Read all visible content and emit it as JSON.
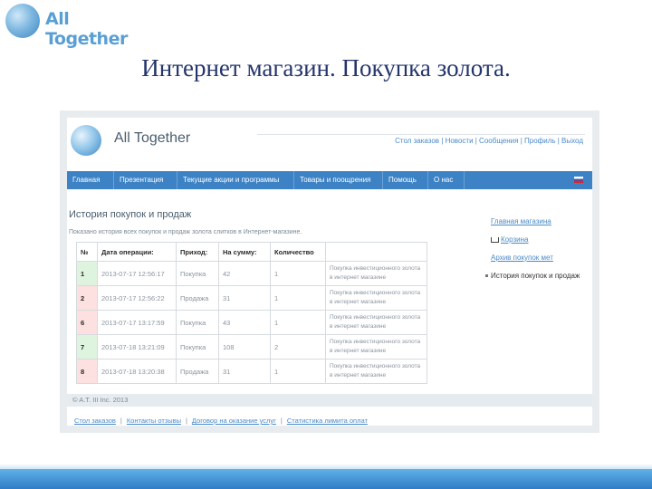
{
  "slide": {
    "logo_text": "All Together",
    "title": "Интернет магазин. Покупка золота."
  },
  "site": {
    "name": "All Together",
    "top_links": "Стол заказов | Новости | Сообщения | Профиль | Выход",
    "nav": [
      "Главная",
      "Презентация",
      "Текущие акции и программы",
      "Товары и поощрения",
      "Помощь",
      "О нас"
    ],
    "history_title": "История покупок и продаж",
    "history_desc": "Показано история всех покупок и продаж золота слитков в Интернет-магазине.",
    "table": {
      "headers": [
        "№",
        "Дата операции:",
        "Приход:",
        "На сумму:",
        "Количество",
        ""
      ],
      "rows": [
        {
          "n": "1",
          "date": "2013-07-17 12:56:17",
          "type": "Покупка",
          "sum": "42",
          "qty": "1",
          "desc": "Покупка инвестиционного золота в интернет магазине"
        },
        {
          "n": "2",
          "date": "2013-07-17 12:56:22",
          "type": "Продажа",
          "sum": "31",
          "qty": "1",
          "desc": "Покупка инвестиционного золота в интернет магазине"
        },
        {
          "n": "6",
          "date": "2013-07-17 13:17:59",
          "type": "Покупка",
          "sum": "43",
          "qty": "1",
          "desc": "Покупка инвестиционного золота в интернет магазине"
        },
        {
          "n": "7",
          "date": "2013-07-18 13:21:09",
          "type": "Покупка",
          "sum": "108",
          "qty": "2",
          "desc": "Покупка инвестиционного золота в интернет магазине"
        },
        {
          "n": "8",
          "date": "2013-07-18 13:20:38",
          "type": "Продажа",
          "sum": "31",
          "qty": "1",
          "desc": "Покупка инвестиционного золота в интернет магазине"
        }
      ]
    },
    "sidebar": {
      "main_link": "Главная магазина",
      "cart": "Корзина",
      "history_link": "Архив покупок мет",
      "active": "История покупок и продаж"
    },
    "copyright": "© A.T. III Inc. 2013",
    "footer_links": [
      "Стол заказов",
      "Контакты отзывы",
      "Договор на оказание услуг",
      "Статистика лимита оплат"
    ]
  },
  "colors": {
    "nav": "#3c82c4",
    "slide_title": "#25356b",
    "link": "#4a8ac8",
    "sale_cell": "#fde0e0",
    "buy_cell": "#dff4df"
  }
}
